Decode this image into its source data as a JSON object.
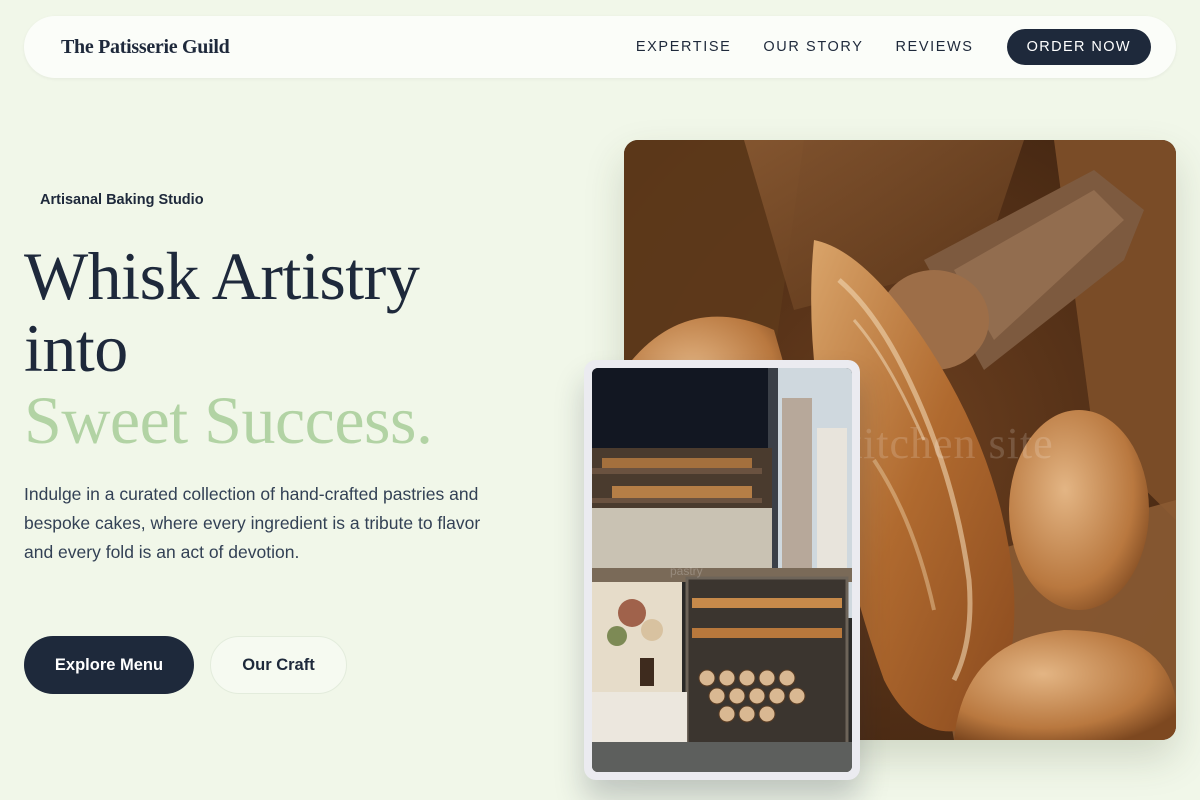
{
  "nav": {
    "brand": "The Patisserie Guild",
    "links": [
      "EXPERTISE",
      "OUR STORY",
      "REVIEWS"
    ],
    "cta": "ORDER NOW"
  },
  "hero": {
    "eyebrow": "Artisanal Baking Studio",
    "headline_line1": "Whisk Artistry",
    "headline_line2": "into",
    "headline_accent": "Sweet Success.",
    "description": "Indulge in a curated collection of hand-crafted pastries and bespoke cakes, where every ingredient is a tribute to flavor and every fold is an act of devotion.",
    "primary_button": "Explore Menu",
    "secondary_button": "Our Craft"
  },
  "images": {
    "main_photo_watermark": "kitchen site",
    "card_photo_watermark": "pastry"
  },
  "colors": {
    "background": "#f1f7e9",
    "navy": "#1e293b",
    "accent_green": "#b2d3a4"
  }
}
